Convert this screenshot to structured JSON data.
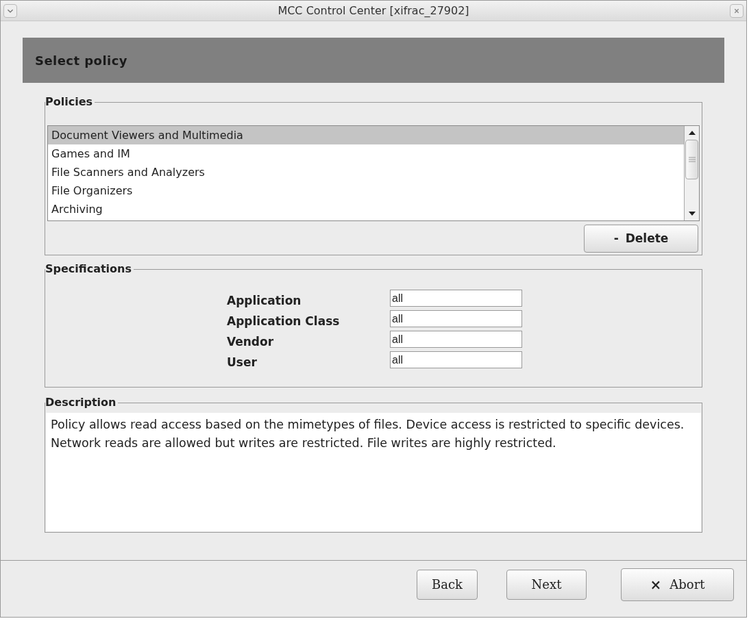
{
  "window": {
    "title": "MCC Control Center [xifrac_27902]"
  },
  "header": {
    "title": "Select policy"
  },
  "policies": {
    "legend": "Policies",
    "items": [
      {
        "label": "Document Viewers and Multimedia",
        "selected": true
      },
      {
        "label": "Games and IM",
        "selected": false
      },
      {
        "label": "File Scanners and Analyzers",
        "selected": false
      },
      {
        "label": "File Organizers",
        "selected": false
      },
      {
        "label": "Archiving",
        "selected": false
      }
    ],
    "delete_button": {
      "icon": "-",
      "label": "Delete"
    }
  },
  "specifications": {
    "legend": "Specifications",
    "fields": [
      {
        "label": "Application",
        "value": "all"
      },
      {
        "label": "Application Class",
        "value": "all"
      },
      {
        "label": "Vendor",
        "value": "all"
      },
      {
        "label": "User",
        "value": "all"
      }
    ]
  },
  "description": {
    "legend": "Description",
    "text": "Policy allows read access based on the mimetypes of files. Device access is restricted to specific devices. Network reads are allowed but writes are restricted. File writes are highly restricted."
  },
  "buttons": [
    {
      "label": "Back"
    },
    {
      "label": "Next"
    },
    {
      "label": "Abort",
      "icon": "×"
    }
  ]
}
